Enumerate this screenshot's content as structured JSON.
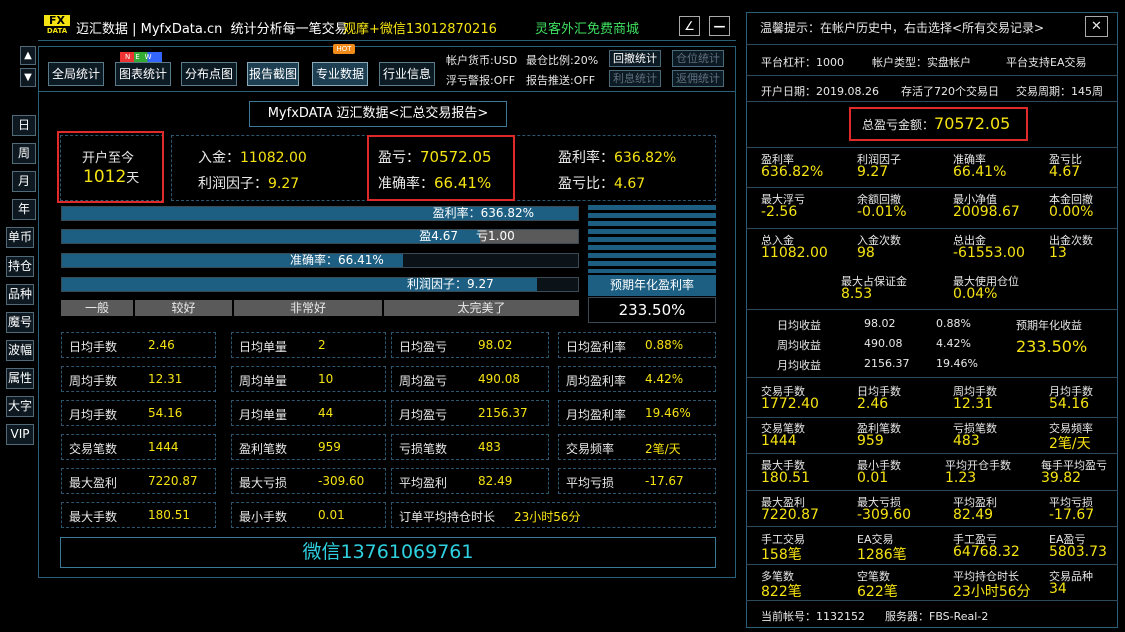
{
  "header": {
    "logo_top": "FX",
    "logo_bottom": "DATA",
    "title": "迈汇数据 | MyfxData.cn  统计分析每一笔交易",
    "promo1": "观摩+微信13012870216",
    "promo2": "灵客外汇免费商城",
    "btn_draw": "∠",
    "btn_min": "—"
  },
  "toolbar": {
    "items": [
      "全局统计",
      "图表统计",
      "分布点图",
      "报告截图",
      "专业数据",
      "行业信息"
    ],
    "badge_new": "NEW",
    "badge_hot": "HOT",
    "acct_currency": "帐户货币:USD",
    "max_ratio": "最仓比例:20%",
    "float_alert": "浮亏警报:OFF",
    "report_push": "报告推送:OFF",
    "btns": [
      "回撤统计",
      "仓位统计",
      "利息统计",
      "返佣统计"
    ]
  },
  "side": {
    "up": "▲",
    "down": "▼",
    "items": [
      "日",
      "周",
      "月",
      "年",
      "单币",
      "持仓",
      "品种",
      "魔号",
      "波幅",
      "属性",
      "大字",
      "VIP"
    ]
  },
  "report_title": "MyfxDATA 迈汇数据<汇总交易报告>",
  "summary": {
    "since_label": "开户至今",
    "days": "1012",
    "days_unit": "天",
    "deposit_label": "入金：",
    "deposit": "11082.00",
    "pf_label": "利润因子：",
    "pf": "9.27",
    "pl_label": "盈亏：",
    "pl": "70572.05",
    "acc_label": "准确率：",
    "acc": "66.41%",
    "roi_label": "盈利率：",
    "roi": "636.82%",
    "plr_label": "盈亏比：",
    "plr": "4.67"
  },
  "bars": {
    "roi": "盈利率：636.82%",
    "win": "盈4.67",
    "loss": "亏1.00",
    "acc": "准确率：66.41%",
    "pf": "利润因子：9.27",
    "win_fill": 0.82,
    "acc_fill": 0.66,
    "pf_fill": 0.92,
    "roi_fill": 1.0,
    "scale": [
      "一般",
      "较好",
      "非常好",
      "太完美了"
    ],
    "annual_label": "预期年化盈利率",
    "annual": "233.50%"
  },
  "grid": [
    [
      [
        "日均手数",
        "2.46"
      ],
      [
        "日均单量",
        "2"
      ],
      [
        "日均盈亏",
        "98.02"
      ],
      [
        "日均盈利率",
        "0.88%"
      ]
    ],
    [
      [
        "周均手数",
        "12.31"
      ],
      [
        "周均单量",
        "10"
      ],
      [
        "周均盈亏",
        "490.08"
      ],
      [
        "周均盈利率",
        "4.42%"
      ]
    ],
    [
      [
        "月均手数",
        "54.16"
      ],
      [
        "月均单量",
        "44"
      ],
      [
        "月均盈亏",
        "2156.37"
      ],
      [
        "月均盈利率",
        "19.46%"
      ]
    ],
    [
      [
        "交易笔数",
        "1444"
      ],
      [
        "盈利笔数",
        "959"
      ],
      [
        "亏损笔数",
        "483"
      ],
      [
        "交易频率",
        "2笔/天"
      ]
    ],
    [
      [
        "最大盈利",
        "7220.87"
      ],
      [
        "最大亏损",
        "-309.60"
      ],
      [
        "平均盈利",
        "82.49"
      ],
      [
        "平均亏损",
        "-17.67"
      ]
    ]
  ],
  "grid_last": [
    [
      "最大手数",
      "180.51"
    ],
    [
      "最小手数",
      "0.01"
    ],
    [
      "订单平均持仓时长",
      "23小时56分"
    ]
  ],
  "wechat": "微信13761069761",
  "right": {
    "tip": "温馨提示：在帐户历史中，右击选择<所有交易记录>",
    "close": "✕",
    "leverage": "平台杠杆：1000",
    "acct_type": "帐户类型：实盘帐户",
    "ea": "平台支持EA交易",
    "open_date": "开户日期：2019.08.26",
    "records": "存活了720个交易日",
    "period": "交易周期：145周",
    "total_label": "总盈亏金额：",
    "total": "70572.05",
    "r1": [
      [
        "盈利率",
        "636.82%"
      ],
      [
        "利润因子",
        "9.27"
      ],
      [
        "准确率",
        "66.41%"
      ],
      [
        "盈亏比",
        "4.67"
      ]
    ],
    "r2": [
      [
        "最大浮亏",
        "-2.56"
      ],
      [
        "余额回撤",
        "-0.01%"
      ],
      [
        "最小净值",
        "20098.67"
      ],
      [
        "本金回撤",
        "0.00%"
      ]
    ],
    "r3": [
      [
        "总入金",
        "11082.00"
      ],
      [
        "入金次数",
        "98"
      ],
      [
        "总出金",
        "-61553.00"
      ],
      [
        "出金次数",
        "13"
      ]
    ],
    "r4": [
      [
        "最大占保证金",
        "8.53"
      ],
      [
        "最大使用仓位",
        "0.04%"
      ]
    ],
    "avg": [
      [
        "日均收益",
        "98.02",
        "0.88%"
      ],
      [
        "周均收益",
        "490.08",
        "4.42%"
      ],
      [
        "月均收益",
        "2156.37",
        "19.46%"
      ]
    ],
    "annual_label": "预期年化收益",
    "annual": "233.50%",
    "r5": [
      [
        "交易手数",
        "1772.40"
      ],
      [
        "日均手数",
        "2.46"
      ],
      [
        "周均手数",
        "12.31"
      ],
      [
        "月均手数",
        "54.16"
      ]
    ],
    "r6": [
      [
        "交易笔数",
        "1444"
      ],
      [
        "盈利笔数",
        "959"
      ],
      [
        "亏损笔数",
        "483"
      ],
      [
        "交易频率",
        "2笔/天"
      ]
    ],
    "r7": [
      [
        "最大手数",
        "180.51"
      ],
      [
        "最小手数",
        "0.01"
      ],
      [
        "平均开仓手数",
        "1.23"
      ],
      [
        "每手平均盈亏",
        "39.82"
      ]
    ],
    "r8": [
      [
        "最大盈利",
        "7220.87"
      ],
      [
        "最大亏损",
        "-309.60"
      ],
      [
        "平均盈利",
        "82.49"
      ],
      [
        "平均亏损",
        "-17.67"
      ]
    ],
    "r9": [
      [
        "手工交易",
        "158笔"
      ],
      [
        "EA交易",
        "1286笔"
      ],
      [
        "手工盈亏",
        "64768.32"
      ],
      [
        "EA盈亏",
        "5803.73"
      ]
    ],
    "r10": [
      [
        "多笔数",
        "822笔"
      ],
      [
        "空笔数",
        "622笔"
      ],
      [
        "平均持仓时长",
        "23小时56分"
      ],
      [
        "交易品种",
        "34"
      ]
    ],
    "account": "当前帐号：1132152",
    "server": "服务器：FBS-Real-2"
  },
  "colors": {
    "accent": "#f5e312",
    "bar": "#1c5f82",
    "red": "#e02a2a",
    "wechat": "#2fd0e0"
  }
}
